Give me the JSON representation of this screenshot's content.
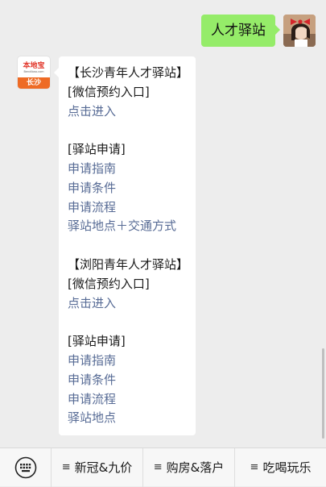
{
  "chat": {
    "outgoing_message": "人才驿站",
    "reply": {
      "avatar": {
        "brand": "本地宝",
        "url": "Bendibao.com",
        "city": "长沙"
      },
      "lines": [
        {
          "text": "【长沙青年人才驿站】",
          "link": false
        },
        {
          "text": "[微信预约入口]",
          "link": false
        },
        {
          "text": "点击进入",
          "link": true
        },
        {
          "text": "",
          "link": false
        },
        {
          "text": "[驿站申请]",
          "link": false
        },
        {
          "text": "申请指南",
          "link": true
        },
        {
          "text": "申请条件",
          "link": true
        },
        {
          "text": "申请流程",
          "link": true
        },
        {
          "text": "驿站地点＋交通方式",
          "link": true
        },
        {
          "text": "",
          "link": false
        },
        {
          "text": "【浏阳青年人才驿站】",
          "link": false
        },
        {
          "text": "[微信预约入口]",
          "link": false
        },
        {
          "text": "点击进入",
          "link": true
        },
        {
          "text": "",
          "link": false
        },
        {
          "text": "[驿站申请]",
          "link": false
        },
        {
          "text": "申请指南",
          "link": true
        },
        {
          "text": "申请条件",
          "link": true
        },
        {
          "text": "申请流程",
          "link": true
        },
        {
          "text": "驿站地点",
          "link": true
        }
      ]
    }
  },
  "menu": {
    "items": [
      {
        "label": "新冠&九价",
        "icon": "≡"
      },
      {
        "label": "购房&落户",
        "icon": "≡"
      },
      {
        "label": "吃喝玩乐",
        "icon": "≡"
      }
    ]
  },
  "colors": {
    "chat_background": "#ededed",
    "outgoing_bubble": "#95ec69",
    "link_text": "#576b95",
    "brand_orange": "#ee6b25"
  }
}
